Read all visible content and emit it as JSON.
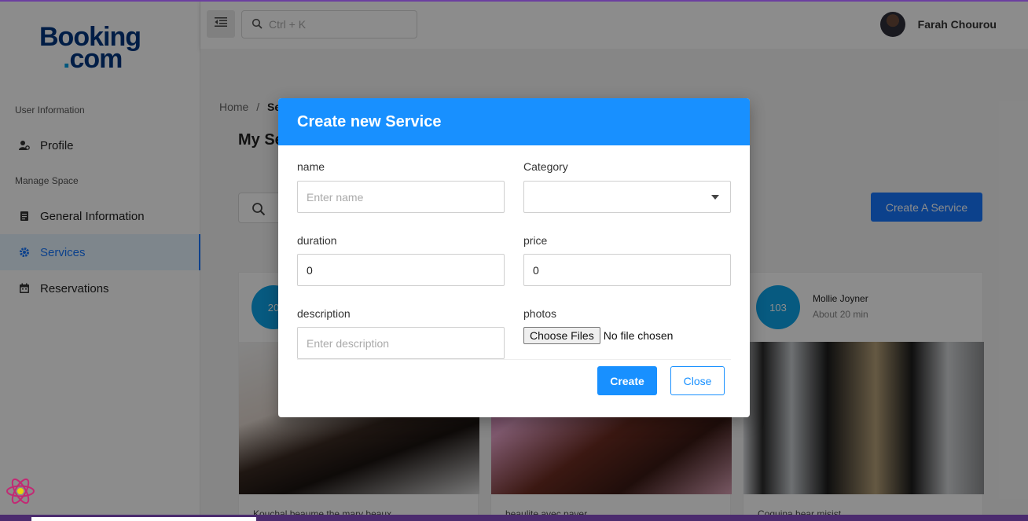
{
  "brand": {
    "line1": "Booking",
    "line2_dot": ".",
    "line2": "com"
  },
  "header": {
    "search_placeholder": "Ctrl + K",
    "user_name": "Farah Chourou"
  },
  "sidebar": {
    "sections": [
      {
        "title": "User Information"
      },
      {
        "title": "Manage Space"
      }
    ],
    "items": [
      {
        "label": "Profile",
        "icon": "user-gear-icon"
      },
      {
        "label": "General Information",
        "icon": "document-icon"
      },
      {
        "label": "Services",
        "icon": "gear-icon",
        "active": true
      },
      {
        "label": "Reservations",
        "icon": "calendar-icon"
      }
    ]
  },
  "content": {
    "breadcrumb": {
      "home": "Home",
      "separator": "/",
      "current": "Se"
    },
    "title": "My Se",
    "create_button": "Create A Service",
    "cards": [
      {
        "badge": "20",
        "name": "",
        "duration": "",
        "desc": "Kouchal beaume the mary beaux"
      },
      {
        "badge": "",
        "name": "",
        "duration": "",
        "desc": "beaulite avec paver"
      },
      {
        "badge": "103",
        "name": "Mollie Joyner",
        "duration": "About 20 min",
        "desc": "Coquina bear misist"
      }
    ]
  },
  "modal": {
    "title": "Create new Service",
    "fields": {
      "name": {
        "label": "name",
        "placeholder": "Enter name"
      },
      "category": {
        "label": "Category",
        "value": ""
      },
      "duration": {
        "label": "duration",
        "value": "0"
      },
      "price": {
        "label": "price",
        "value": "0"
      },
      "description": {
        "label": "description",
        "placeholder": "Enter description"
      },
      "photos": {
        "label": "photos",
        "button": "Choose Files",
        "status": "No file chosen"
      }
    },
    "create_label": "Create",
    "close_label": "Close"
  },
  "colors": {
    "primary": "#1890ff",
    "brand": "#003580",
    "badge": "#0ea5e9",
    "active_bg": "#e6f4ff"
  }
}
